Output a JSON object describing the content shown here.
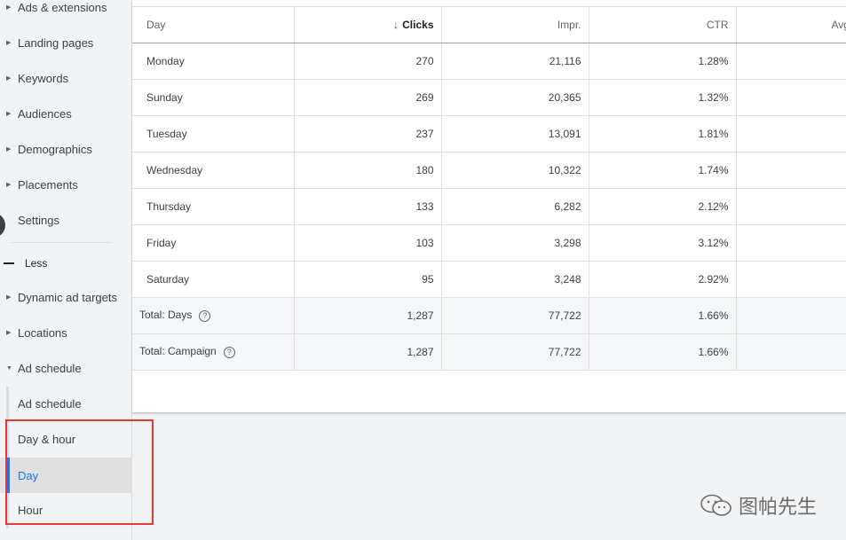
{
  "sidebar": {
    "items": [
      {
        "label": "Ads & extensions"
      },
      {
        "label": "Landing pages"
      },
      {
        "label": "Keywords"
      },
      {
        "label": "Audiences"
      },
      {
        "label": "Demographics"
      },
      {
        "label": "Placements"
      },
      {
        "label": "Settings"
      }
    ],
    "less_label": "Less",
    "more_items": [
      {
        "label": "Dynamic ad targets"
      },
      {
        "label": "Locations"
      },
      {
        "label": "Ad schedule"
      }
    ],
    "sub_items": [
      {
        "label": "Ad schedule"
      },
      {
        "label": "Day & hour"
      },
      {
        "label": "Day"
      },
      {
        "label": "Hour"
      }
    ],
    "active_sub_item": "Day"
  },
  "table": {
    "headers": [
      "Day",
      "Clicks",
      "Impr.",
      "CTR",
      "Avg"
    ],
    "sorted_column": "Clicks",
    "sort_direction": "descending",
    "rows": [
      {
        "day": "Monday",
        "clicks": "270",
        "impr": "21,116",
        "ctr": "1.28%"
      },
      {
        "day": "Sunday",
        "clicks": "269",
        "impr": "20,365",
        "ctr": "1.32%"
      },
      {
        "day": "Tuesday",
        "clicks": "237",
        "impr": "13,091",
        "ctr": "1.81%"
      },
      {
        "day": "Wednesday",
        "clicks": "180",
        "impr": "10,322",
        "ctr": "1.74%"
      },
      {
        "day": "Thursday",
        "clicks": "133",
        "impr": "6,282",
        "ctr": "2.12%"
      },
      {
        "day": "Friday",
        "clicks": "103",
        "impr": "3,298",
        "ctr": "3.12%"
      },
      {
        "day": "Saturday",
        "clicks": "95",
        "impr": "3,248",
        "ctr": "2.92%"
      }
    ],
    "totals": [
      {
        "label": "Total: Days",
        "clicks": "1,287",
        "impr": "77,722",
        "ctr": "1.66%"
      },
      {
        "label": "Total: Campaign",
        "clicks": "1,287",
        "impr": "77,722",
        "ctr": "1.66%"
      }
    ],
    "help_glyph": "?",
    "sort_arrow": "↓"
  },
  "watermark": {
    "text": "图帕先生"
  },
  "colors": {
    "accent": "#1a73e8",
    "highlight_box": "#e53935"
  }
}
